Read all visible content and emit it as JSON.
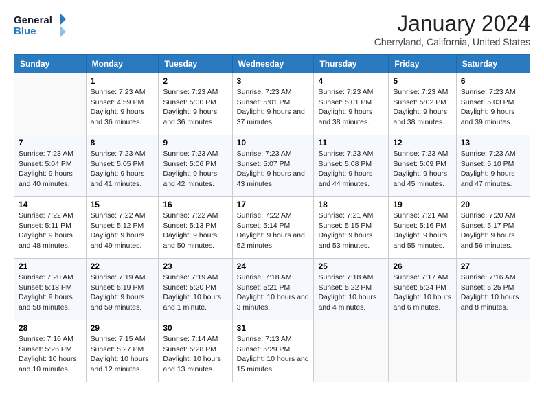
{
  "header": {
    "logo_general": "General",
    "logo_blue": "Blue",
    "month_year": "January 2024",
    "location": "Cherryland, California, United States"
  },
  "days_of_week": [
    "Sunday",
    "Monday",
    "Tuesday",
    "Wednesday",
    "Thursday",
    "Friday",
    "Saturday"
  ],
  "weeks": [
    [
      {
        "day": "",
        "sunrise": "",
        "sunset": "",
        "daylight": ""
      },
      {
        "day": "1",
        "sunrise": "Sunrise: 7:23 AM",
        "sunset": "Sunset: 4:59 PM",
        "daylight": "Daylight: 9 hours and 36 minutes."
      },
      {
        "day": "2",
        "sunrise": "Sunrise: 7:23 AM",
        "sunset": "Sunset: 5:00 PM",
        "daylight": "Daylight: 9 hours and 36 minutes."
      },
      {
        "day": "3",
        "sunrise": "Sunrise: 7:23 AM",
        "sunset": "Sunset: 5:01 PM",
        "daylight": "Daylight: 9 hours and 37 minutes."
      },
      {
        "day": "4",
        "sunrise": "Sunrise: 7:23 AM",
        "sunset": "Sunset: 5:01 PM",
        "daylight": "Daylight: 9 hours and 38 minutes."
      },
      {
        "day": "5",
        "sunrise": "Sunrise: 7:23 AM",
        "sunset": "Sunset: 5:02 PM",
        "daylight": "Daylight: 9 hours and 38 minutes."
      },
      {
        "day": "6",
        "sunrise": "Sunrise: 7:23 AM",
        "sunset": "Sunset: 5:03 PM",
        "daylight": "Daylight: 9 hours and 39 minutes."
      }
    ],
    [
      {
        "day": "7",
        "sunrise": "Sunrise: 7:23 AM",
        "sunset": "Sunset: 5:04 PM",
        "daylight": "Daylight: 9 hours and 40 minutes."
      },
      {
        "day": "8",
        "sunrise": "Sunrise: 7:23 AM",
        "sunset": "Sunset: 5:05 PM",
        "daylight": "Daylight: 9 hours and 41 minutes."
      },
      {
        "day": "9",
        "sunrise": "Sunrise: 7:23 AM",
        "sunset": "Sunset: 5:06 PM",
        "daylight": "Daylight: 9 hours and 42 minutes."
      },
      {
        "day": "10",
        "sunrise": "Sunrise: 7:23 AM",
        "sunset": "Sunset: 5:07 PM",
        "daylight": "Daylight: 9 hours and 43 minutes."
      },
      {
        "day": "11",
        "sunrise": "Sunrise: 7:23 AM",
        "sunset": "Sunset: 5:08 PM",
        "daylight": "Daylight: 9 hours and 44 minutes."
      },
      {
        "day": "12",
        "sunrise": "Sunrise: 7:23 AM",
        "sunset": "Sunset: 5:09 PM",
        "daylight": "Daylight: 9 hours and 45 minutes."
      },
      {
        "day": "13",
        "sunrise": "Sunrise: 7:23 AM",
        "sunset": "Sunset: 5:10 PM",
        "daylight": "Daylight: 9 hours and 47 minutes."
      }
    ],
    [
      {
        "day": "14",
        "sunrise": "Sunrise: 7:22 AM",
        "sunset": "Sunset: 5:11 PM",
        "daylight": "Daylight: 9 hours and 48 minutes."
      },
      {
        "day": "15",
        "sunrise": "Sunrise: 7:22 AM",
        "sunset": "Sunset: 5:12 PM",
        "daylight": "Daylight: 9 hours and 49 minutes."
      },
      {
        "day": "16",
        "sunrise": "Sunrise: 7:22 AM",
        "sunset": "Sunset: 5:13 PM",
        "daylight": "Daylight: 9 hours and 50 minutes."
      },
      {
        "day": "17",
        "sunrise": "Sunrise: 7:22 AM",
        "sunset": "Sunset: 5:14 PM",
        "daylight": "Daylight: 9 hours and 52 minutes."
      },
      {
        "day": "18",
        "sunrise": "Sunrise: 7:21 AM",
        "sunset": "Sunset: 5:15 PM",
        "daylight": "Daylight: 9 hours and 53 minutes."
      },
      {
        "day": "19",
        "sunrise": "Sunrise: 7:21 AM",
        "sunset": "Sunset: 5:16 PM",
        "daylight": "Daylight: 9 hours and 55 minutes."
      },
      {
        "day": "20",
        "sunrise": "Sunrise: 7:20 AM",
        "sunset": "Sunset: 5:17 PM",
        "daylight": "Daylight: 9 hours and 56 minutes."
      }
    ],
    [
      {
        "day": "21",
        "sunrise": "Sunrise: 7:20 AM",
        "sunset": "Sunset: 5:18 PM",
        "daylight": "Daylight: 9 hours and 58 minutes."
      },
      {
        "day": "22",
        "sunrise": "Sunrise: 7:19 AM",
        "sunset": "Sunset: 5:19 PM",
        "daylight": "Daylight: 9 hours and 59 minutes."
      },
      {
        "day": "23",
        "sunrise": "Sunrise: 7:19 AM",
        "sunset": "Sunset: 5:20 PM",
        "daylight": "Daylight: 10 hours and 1 minute."
      },
      {
        "day": "24",
        "sunrise": "Sunrise: 7:18 AM",
        "sunset": "Sunset: 5:21 PM",
        "daylight": "Daylight: 10 hours and 3 minutes."
      },
      {
        "day": "25",
        "sunrise": "Sunrise: 7:18 AM",
        "sunset": "Sunset: 5:22 PM",
        "daylight": "Daylight: 10 hours and 4 minutes."
      },
      {
        "day": "26",
        "sunrise": "Sunrise: 7:17 AM",
        "sunset": "Sunset: 5:24 PM",
        "daylight": "Daylight: 10 hours and 6 minutes."
      },
      {
        "day": "27",
        "sunrise": "Sunrise: 7:16 AM",
        "sunset": "Sunset: 5:25 PM",
        "daylight": "Daylight: 10 hours and 8 minutes."
      }
    ],
    [
      {
        "day": "28",
        "sunrise": "Sunrise: 7:16 AM",
        "sunset": "Sunset: 5:26 PM",
        "daylight": "Daylight: 10 hours and 10 minutes."
      },
      {
        "day": "29",
        "sunrise": "Sunrise: 7:15 AM",
        "sunset": "Sunset: 5:27 PM",
        "daylight": "Daylight: 10 hours and 12 minutes."
      },
      {
        "day": "30",
        "sunrise": "Sunrise: 7:14 AM",
        "sunset": "Sunset: 5:28 PM",
        "daylight": "Daylight: 10 hours and 13 minutes."
      },
      {
        "day": "31",
        "sunrise": "Sunrise: 7:13 AM",
        "sunset": "Sunset: 5:29 PM",
        "daylight": "Daylight: 10 hours and 15 minutes."
      },
      {
        "day": "",
        "sunrise": "",
        "sunset": "",
        "daylight": ""
      },
      {
        "day": "",
        "sunrise": "",
        "sunset": "",
        "daylight": ""
      },
      {
        "day": "",
        "sunrise": "",
        "sunset": "",
        "daylight": ""
      }
    ]
  ]
}
